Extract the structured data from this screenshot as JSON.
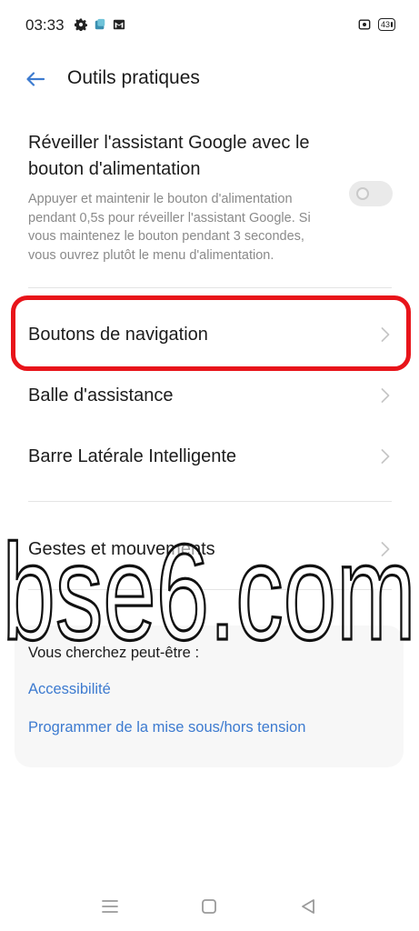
{
  "status_bar": {
    "time": "03:33",
    "battery": "43",
    "left_icons": [
      "gear-icon",
      "app-notification-icon",
      "gmail-icon"
    ],
    "right_icons": [
      "screen-record-icon",
      "battery-icon"
    ]
  },
  "header": {
    "title": "Outils pratiques",
    "back_icon": "arrow-left-icon"
  },
  "power_button_setting": {
    "title": "Réveiller l'assistant Google avec le bouton d'alimentation",
    "description": "Appuyer et maintenir le bouton d'alimentation pendant 0,5s pour réveiller l'assistant Google. Si vous maintenez le bouton pendant 3 secondes, vous ouvrez plutôt le menu d'alimentation.",
    "toggle_state": "off"
  },
  "menu_items": [
    {
      "label": "Boutons de navigation",
      "icon": "chevron-right-icon"
    },
    {
      "label": "Balle d'assistance",
      "icon": "chevron-right-icon"
    },
    {
      "label": "Barre Latérale Intelligente",
      "icon": "chevron-right-icon"
    },
    {
      "label": "Gestes et mouvements",
      "icon": "chevron-right-icon"
    }
  ],
  "suggestions": {
    "heading": "Vous cherchez peut-être :",
    "links": [
      "Accessibilité",
      "Programmer de la mise sous/hors tension"
    ]
  },
  "watermark": "bse6.com",
  "colors": {
    "accent": "#3d7bd0",
    "highlight": "#e8141a",
    "secondary_text": "#8a8a8a",
    "card_background": "#f7f7f7"
  },
  "bottom_nav": {
    "icons": [
      "menu-icon",
      "home-icon",
      "back-triangle-icon"
    ]
  }
}
